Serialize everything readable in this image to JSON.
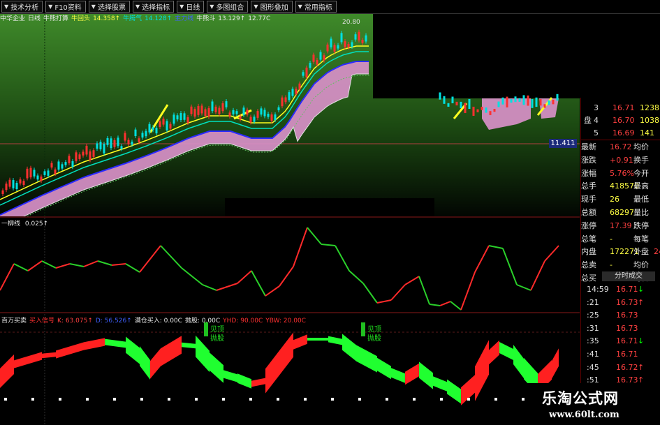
{
  "toolbar": {
    "items": [
      "技术分析",
      "F10资料",
      "选择股票",
      "选择指标",
      "日线",
      "多图组合",
      "图形叠加",
      "常用指标"
    ]
  },
  "info": {
    "items": [
      {
        "text": "中华企业",
        "color": "#e8e8e8"
      },
      {
        "text": "日线",
        "color": "#e8e8e8"
      },
      {
        "text": "牛熊打算",
        "color": "#e8e8e8"
      },
      {
        "text": "牛回头",
        "color": "#ffff44"
      },
      {
        "text": "14.358↑",
        "color": "#ffff44"
      },
      {
        "text": "牛腾气",
        "color": "#00e0e0"
      },
      {
        "text": "14.128↑",
        "color": "#00e0e0"
      },
      {
        "text": "主力线",
        "color": "#4060ff"
      },
      {
        "text": "牛熊斗",
        "color": "#e8e8e8"
      },
      {
        "text": "13.129↑",
        "color": "#e8e8e8"
      },
      {
        "text": "12.77C",
        "color": "#e8e8e8"
      }
    ],
    "chart_top_label": "20.80"
  },
  "price_tag": "11.411",
  "osc": {
    "label_name": "一柳线",
    "label_value": "0.025↑"
  },
  "bottom_panel": {
    "items": [
      {
        "text": "百万买卖",
        "color": "#e8e8e8"
      },
      {
        "text": "买入信号",
        "color": "#ff3030"
      },
      {
        "text": "K: 63.075↑",
        "color": "#ff4040"
      },
      {
        "text": "D: 56.526↑",
        "color": "#4060ff"
      },
      {
        "text": "满仓买入: 0.00C",
        "color": "#e8e8e8"
      },
      {
        "text": "抛股: 0.00C",
        "color": "#e8e8e8"
      },
      {
        "text": "YHD: 90.00C",
        "color": "#ff3030"
      },
      {
        "text": "YBW: 20.00C",
        "color": "#ff3030"
      }
    ],
    "marker1": [
      "见顶",
      "抛股"
    ],
    "marker2": [
      "见顶",
      "抛股"
    ]
  },
  "quote": {
    "order_rows": [
      {
        "num": "3",
        "price": "16.71",
        "vol": "1238"
      },
      {
        "num": "4",
        "price": "16.70",
        "vol": "1038"
      },
      {
        "num": "5",
        "price": "16.69",
        "vol": "141"
      }
    ],
    "side_label": "盘",
    "stats": [
      {
        "l1": "最新",
        "v1": "16.72",
        "l2": "均价",
        "v1color": "#ff4040"
      },
      {
        "l1": "涨跌",
        "v1": "+0.91",
        "l2": "换手",
        "v1color": "#ff4040"
      },
      {
        "l1": "涨幅",
        "v1": "5.76%",
        "l2": "今开",
        "v1color": "#ff4040"
      },
      {
        "l1": "总手",
        "v1": "418570",
        "l2": "最高",
        "v1color": "#ffff44"
      },
      {
        "l1": "现手",
        "v1": "26",
        "l2": "最低",
        "v1color": "#ffff44"
      },
      {
        "l1": "总额",
        "v1": "68297",
        "l2": "量比",
        "v1color": "#ffff44"
      },
      {
        "l1": "涨停",
        "v1": "17.39",
        "l2": "跌停",
        "v1color": "#ff4040"
      },
      {
        "l1": "总笔",
        "v1": "-",
        "l2": "每笔",
        "v1color": "#ffff44"
      },
      {
        "l1": "内盘",
        "v1": "172271",
        "l2": "外盘",
        "v1color": "#ffff44",
        "v3": "24"
      },
      {
        "l1": "总卖",
        "v1": "-",
        "l2": "均价",
        "v1color": "#ffff44"
      },
      {
        "l1": "总买",
        "v1": "-",
        "l2": "均价",
        "v1color": "#ffff44"
      }
    ],
    "tick_header": "分时成交",
    "ticks": [
      {
        "time": "14:59",
        "price": "16.71",
        "dir": "↓",
        "dcolor": "#00ff00"
      },
      {
        "time": ":21",
        "price": "16.73",
        "dir": "↑",
        "dcolor": "#ff4040"
      },
      {
        "time": ":25",
        "price": "16.73",
        "dir": "",
        "dcolor": "#ff4040"
      },
      {
        "time": ":31",
        "price": "16.73",
        "dir": "",
        "dcolor": "#ff4040"
      },
      {
        "time": ":35",
        "price": "16.71",
        "dir": "↓",
        "dcolor": "#00ff00"
      },
      {
        "time": ":41",
        "price": "16.71",
        "dir": "",
        "dcolor": "#ff4040"
      },
      {
        "time": ":45",
        "price": "16.72",
        "dir": "↑",
        "dcolor": "#ff4040"
      },
      {
        "time": ":51",
        "price": "16.73",
        "dir": "↑",
        "dcolor": "#ff4040"
      }
    ]
  },
  "watermark": {
    "title": "乐淘公式网",
    "url": "www.60lt.com"
  }
}
